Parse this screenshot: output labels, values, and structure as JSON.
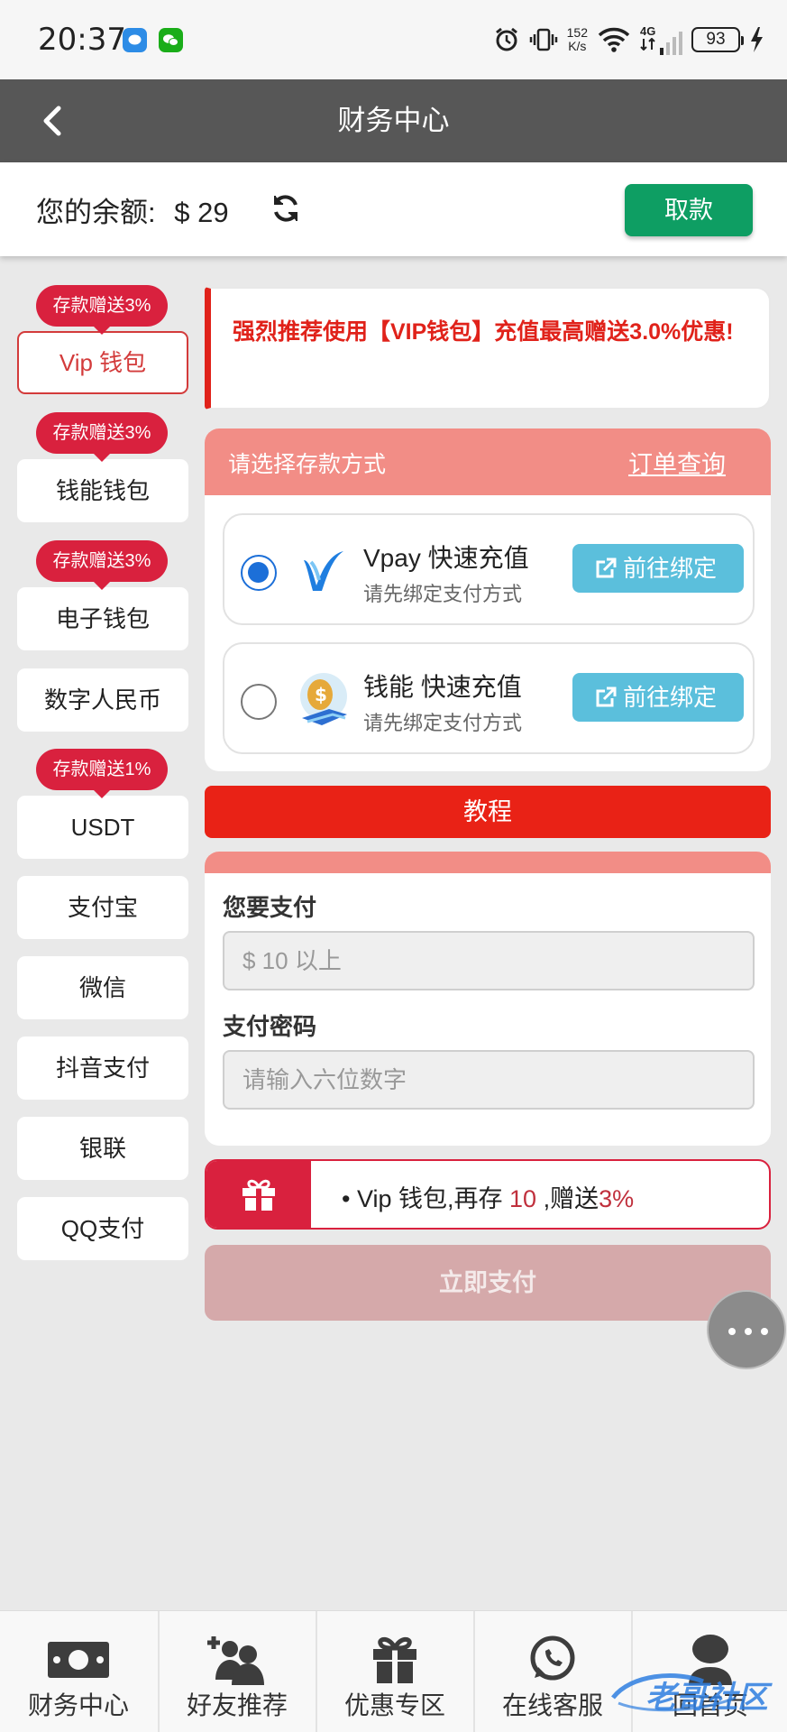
{
  "status_bar": {
    "time": "20:37",
    "speed_value": "152",
    "speed_unit": "K/s",
    "network": "4G",
    "sim": "6",
    "battery": "93"
  },
  "header": {
    "title": "财务中心"
  },
  "balance": {
    "label": "您的余额:",
    "value": "$ 29",
    "withdraw_label": "取款"
  },
  "left_menu": {
    "items": [
      {
        "label": "Vip 钱包",
        "badge": "存款赠送3%"
      },
      {
        "label": "钱能钱包",
        "badge": "存款赠送3%"
      },
      {
        "label": "电子钱包",
        "badge": "存款赠送3%"
      },
      {
        "label": "数字人民币"
      },
      {
        "label": "USDT",
        "badge": "存款赠送1%"
      },
      {
        "label": "支付宝"
      },
      {
        "label": "微信"
      },
      {
        "label": "抖音支付"
      },
      {
        "label": "银联"
      },
      {
        "label": "QQ支付"
      }
    ]
  },
  "recommend": {
    "text": "强烈推荐使用【VIP钱包】充值最高赠送3.0%优惠!"
  },
  "payment_methods": {
    "title": "请选择存款方式",
    "order_link": "订单查询",
    "items": [
      {
        "name": "Vpay 快速充值",
        "sub": "请先绑定支付方式",
        "button": "前往绑定",
        "selected": true
      },
      {
        "name": "钱能 快速充值",
        "sub": "请先绑定支付方式",
        "button": "前往绑定",
        "selected": false
      }
    ]
  },
  "tutorial": {
    "label": "教程"
  },
  "form": {
    "amount_label": "您要支付",
    "amount_placeholder": "$ 10 以上",
    "password_label": "支付密码",
    "password_placeholder": "请输入六位数字"
  },
  "bonus": {
    "bullet": "•",
    "prefix": "Vip 钱包,再存",
    "amount": "10",
    "middle": ",赠送",
    "percent": "3%"
  },
  "pay_now": {
    "label": "立即支付"
  },
  "bottom_nav": {
    "items": [
      {
        "label": "财务中心",
        "icon": "money-icon"
      },
      {
        "label": "好友推荐",
        "icon": "add-friends-icon"
      },
      {
        "label": "优惠专区",
        "icon": "gift-icon"
      },
      {
        "label": "在线客服",
        "icon": "whatsapp-icon"
      },
      {
        "label": "回首页",
        "icon": "home-user-icon"
      }
    ]
  },
  "watermark": "老哥社区",
  "colors": {
    "header_bg": "#575757",
    "withdraw_green": "#0e9e63",
    "promo_red": "#d9213e",
    "accent_salmon": "#f28d86",
    "bind_blue": "#5bbfdc",
    "tutorial_red": "#e92216",
    "radio_blue": "#1c6fd8"
  }
}
